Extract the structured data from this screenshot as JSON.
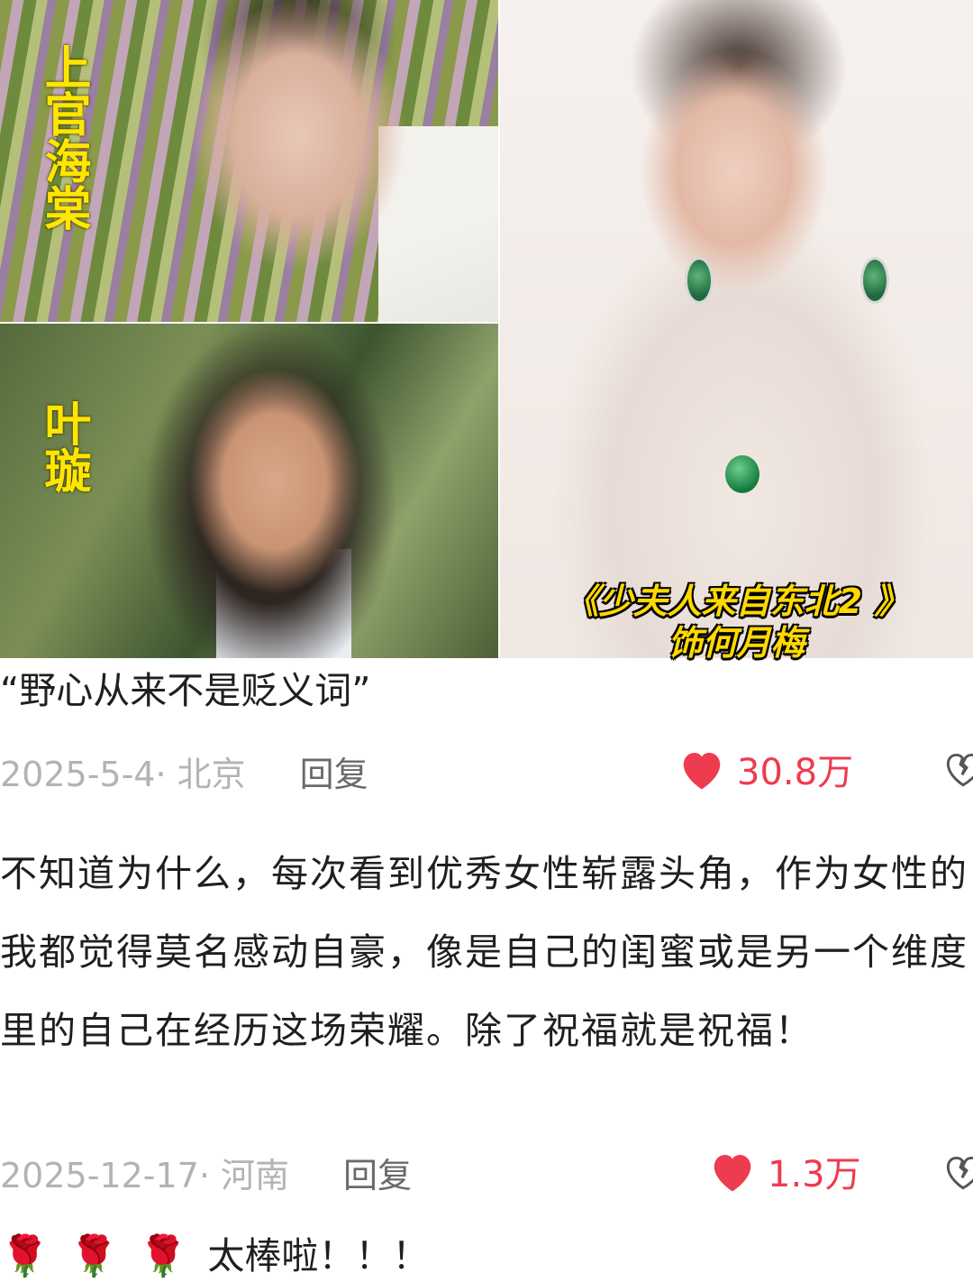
{
  "collage": {
    "label_character_1": "上官海棠",
    "label_character_2": "叶璇",
    "caption_line_1": "《少夫人来自东北2 》",
    "caption_line_2": "饰何月梅"
  },
  "comments": [
    {
      "text": "“野心从来不是贬义词”",
      "date_location": "2025-5-4· 北京",
      "reply_label": "回复",
      "likes": "30.8万"
    },
    {
      "text": "不知道为什么，每次看到优秀女性崭露头角，作为女性的我都觉得莫名感动自豪，像是自己的闺蜜或是另一个维度里的自己在经历这场荣耀。除了祝福就是祝福！",
      "date_location": "2025-12-17· 河南",
      "reply_label": "回复",
      "likes": "1.3万"
    },
    {
      "emoji": [
        "🌹",
        "🌹",
        "🌹"
      ],
      "text": "太棒啦！！！"
    }
  ],
  "colors": {
    "like_red": "#ee3b4f",
    "meta_gray": "#b3b3b3",
    "caption_yellow": "#ffd800"
  }
}
